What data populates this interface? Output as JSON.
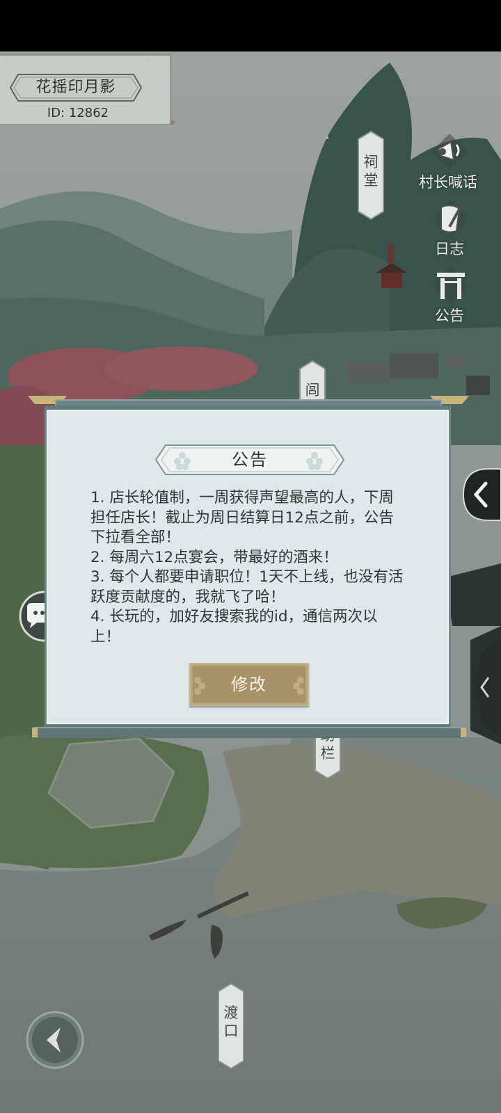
{
  "player": {
    "name": "花摇印月影",
    "id_text": "ID: 12862"
  },
  "locations": {
    "ancestral_hall": "祠堂",
    "alley": "闾",
    "stable_partial": "助栏",
    "ferry": "渡口"
  },
  "side_buttons": {
    "village_chief_shout": "村长喊话",
    "log": "日志",
    "notice": "公告"
  },
  "dialog": {
    "title": "公告",
    "lines": [
      "1. 店长轮值制，一周获得声望最高的人，下周担任店长！截止为周日结算日12点之前，公告下拉看全部！",
      "2. 每周六12点宴会，带最好的酒来！",
      "3. 每个人都要申请职位！1天不上线，也没有活跃度贡献度的，我就飞了哈！",
      "4. 长玩的，加好友搜索我的id，通信两次以上！"
    ],
    "edit_button": "修改"
  },
  "colors": {
    "panel_bg": "#dfe8e8",
    "panel_border": "#5f7b7c",
    "button_gold": "#a8926a",
    "status_bar": "#000000"
  }
}
